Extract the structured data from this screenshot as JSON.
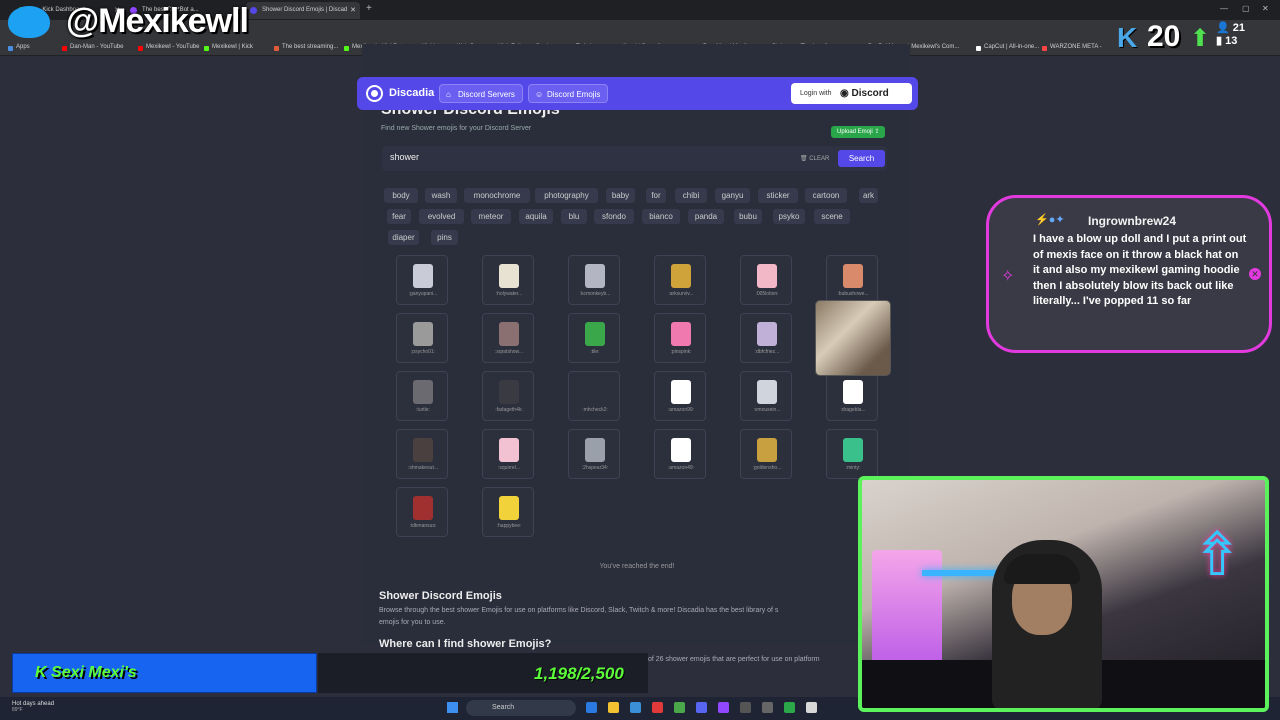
{
  "browser": {
    "tabs": [
      {
        "title": "Str...Kick Dashboard",
        "color": "#53fc18"
      },
      {
        "title": "The best ChatBot a...",
        "color": "#9146ff"
      },
      {
        "title": "Shower Discord Emojis | Discad",
        "color": "#5448e8"
      }
    ],
    "bookmarks": [
      {
        "label": "Apps",
        "color": "#4a90e2"
      },
      {
        "label": "Dan-Man - YouTube",
        "color": "#ff0000"
      },
      {
        "label": "Mexikewl - YouTube",
        "color": "#ff0000"
      },
      {
        "label": "Mexikewl | Kick",
        "color": "#53fc18"
      },
      {
        "label": "The best streaming...",
        "color": "#e25c3a"
      },
      {
        "label": "Mexikewl - KickBot",
        "color": "#53fc18"
      },
      {
        "label": "Kicklet.app - Kick C...",
        "color": "#ffcc00"
      },
      {
        "label": "Kick Follower Goal -...",
        "color": "#ff7a00"
      },
      {
        "label": "Twitch",
        "color": "#9146ff"
      },
      {
        "label": "mexikewl (@mexike...",
        "color": "#ffffff"
      },
      {
        "label": "",
        "color": "#ffffff"
      },
      {
        "label": "Dan-Man / Mexike...",
        "color": "#e1306c"
      },
      {
        "label": "Stake.us - The Leadi...",
        "color": "#dddddd"
      },
      {
        "label": "PayPal.Me",
        "color": "#009cde"
      },
      {
        "label": "-| Mexikewl's Com...",
        "color": "#5448e8"
      },
      {
        "label": "CapCut | All-in-one...",
        "color": "#ffffff"
      },
      {
        "label": "WARZONE META -",
        "color": "#ff4444"
      }
    ]
  },
  "nav": {
    "brand": "Discadia",
    "servers": "Discord Servers",
    "emojis": "Discord Emojis",
    "login_prefix": "Login with",
    "login_brand": "Discord"
  },
  "header": {
    "title": "Shower Discord Emojis",
    "subtitle": "Find new Shower emojis for your Discord Server",
    "upload": "Upload Emoji"
  },
  "search": {
    "value": "shower",
    "clear": "CLEAR",
    "button": "Search"
  },
  "tags": [
    "body",
    "wash",
    "monochrome",
    "photography",
    "baby",
    "for",
    "chibi",
    "ganyu",
    "sticker",
    "cartoon",
    "ark",
    "fear",
    "evolved",
    "meteor",
    "aquila",
    "blu",
    "sfondo",
    "bianco",
    "panda",
    "bubu",
    "psyko",
    "scene",
    "diaper",
    "pins"
  ],
  "emojis": [
    {
      "label": ":ganyupani...",
      "color": "#c9ccd6"
    },
    {
      "label": ":holywater...",
      "color": "#e8e2d2"
    },
    {
      "label": ":kcmonkeyb...",
      "color": "#b3b6c2"
    },
    {
      "label": ":arksurviv...",
      "color": "#cfa23a"
    },
    {
      "label": ":005lotion:",
      "color": "#f2b8c8"
    },
    {
      "label": ":bubushowe...",
      "color": "#d98a6a"
    },
    {
      "label": ":psycho01:",
      "color": "#9a9a9a"
    },
    {
      "label": ":sqratshow...",
      "color": "#8a7070"
    },
    {
      "label": ":tile:",
      "color": "#3aa84a"
    },
    {
      "label": ":pinspink:",
      "color": "#f07ab0"
    },
    {
      "label": ":dbfcfriez...",
      "color": "#c0b0d8"
    },
    {
      "label": "",
      "color": "#2c2f3c"
    },
    {
      "label": ":turtle:",
      "color": "#6a6a70"
    },
    {
      "label": ":fadageth4k:",
      "color": "#3a3a42"
    },
    {
      "label": ":mhcheck2:",
      "color": "#2c2f3c"
    },
    {
      "label": ":amazon99:",
      "color": "#ffffff"
    },
    {
      "label": ":vmousein...",
      "color": "#d0d4dc"
    },
    {
      "label": ":dragebla...",
      "color": "#ffffff"
    },
    {
      "label": ":shmakeout...",
      "color": "#4a4040"
    },
    {
      "label": ":squirrel...",
      "color": "#f2c2d2"
    },
    {
      "label": ":2hspear34:",
      "color": "#9aa0aa"
    },
    {
      "label": ":amazon49:",
      "color": "#ffffff"
    },
    {
      "label": ":goldensho...",
      "color": "#c8a040"
    },
    {
      "label": ":minty:",
      "color": "#3ac08a"
    },
    {
      "label": ":idkmansus:",
      "color": "#a03030"
    },
    {
      "label": ":happybee:",
      "color": "#f2d23a"
    }
  ],
  "end_text": "You've reached the end!",
  "article": {
    "h2a": "Shower Discord Emojis",
    "p1": "Browse through the best shower Emojis for use on platforms like Discord, Slack, Twitch & more! Discadia has the best library of s",
    "p1b": "emojis for you to use.",
    "h2b": "Where can I find shower Emojis?",
    "p2": "of 26 shower emojis that are perfect for use on platform"
  },
  "overlay": {
    "twitter_handle": "@Mexikewll",
    "kick_followers": "20",
    "viewers_a": "21",
    "viewers_b": "13",
    "chat_user": "Ingrownbrew24",
    "chat_message": "I have a blow up doll and I put a print out of mexis face on it throw a black hat on it and also my mexikewl gaming hoodie then I absolutely blow its back out like literally... I've popped 11 so far",
    "goal_label": "Sexi Mexi's",
    "goal_value": "1,198/2,500",
    "goal_progress": 0.479
  },
  "taskbar": {
    "weather_main": "Hot days ahead",
    "weather_temp": "89°F",
    "search": "Search"
  }
}
